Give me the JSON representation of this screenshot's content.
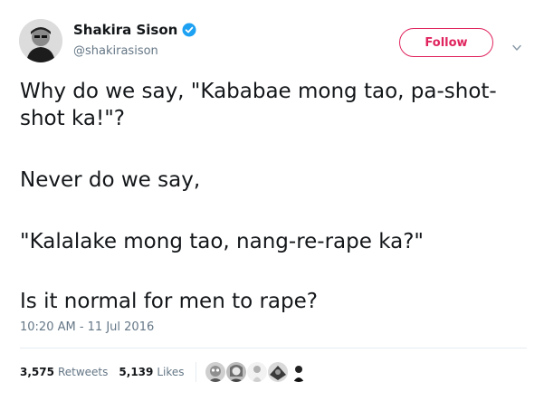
{
  "author": {
    "display_name": "Shakira Sison",
    "handle": "@shakirasison",
    "verified": true
  },
  "follow_label": "Follow",
  "tweet": {
    "paragraphs": [
      "Why do we say, \"Kababae mong tao, pa-shot-shot ka!\"?",
      "Never do we say,",
      "\"Kalalake mong tao, nang-re-rape ka?\"",
      "Is it normal for men to rape?"
    ],
    "timestamp": "10:20 AM - 11 Jul 2016"
  },
  "stats": {
    "retweets_count": "3,575",
    "retweets_label": "Retweets",
    "likes_count": "5,139",
    "likes_label": "Likes"
  },
  "colors": {
    "accent": "#e0245e",
    "verified": "#1da1f2",
    "secondary_text": "#657786",
    "divider": "#e6ecf0"
  },
  "icons": {
    "verified": "verified-badge-icon",
    "caret": "chevron-down-icon"
  }
}
